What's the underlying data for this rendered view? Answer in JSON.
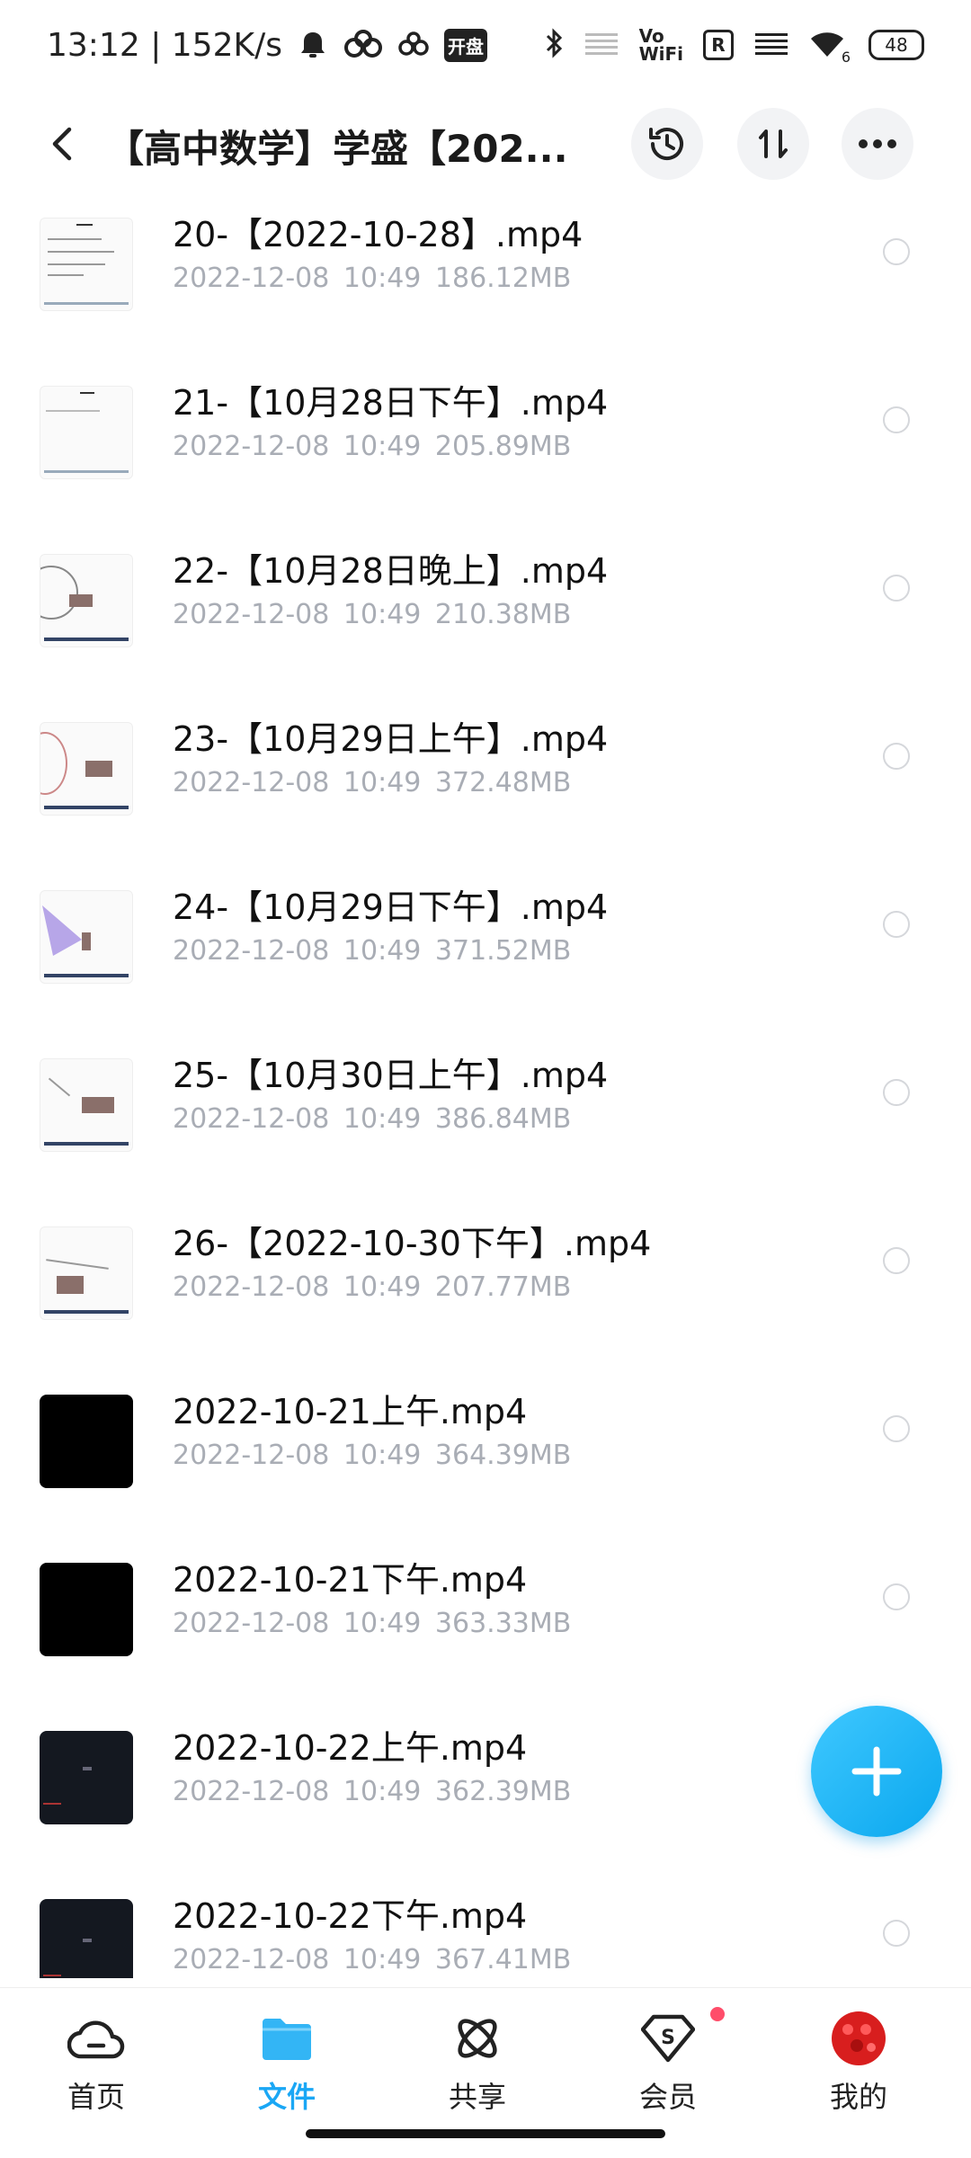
{
  "status_bar": {
    "time_speed": "13:12 | 152K/s",
    "kai_badge": "开盘",
    "vo": "Vo",
    "wifi": "WiFi",
    "r_badge": "R",
    "wifi_sub": "6",
    "battery": "48"
  },
  "header": {
    "title": "【高中数学】学盛【202..."
  },
  "files": [
    {
      "name": "20-【2022-10-28】.mp4",
      "date": "2022-12-08",
      "time": "10:49",
      "size": "186.12MB"
    },
    {
      "name": "21-【10月28日下午】.mp4",
      "date": "2022-12-08",
      "time": "10:49",
      "size": "205.89MB"
    },
    {
      "name": "22-【10月28日晚上】.mp4",
      "date": "2022-12-08",
      "time": "10:49",
      "size": "210.38MB"
    },
    {
      "name": "23-【10月29日上午】.mp4",
      "date": "2022-12-08",
      "time": "10:49",
      "size": "372.48MB"
    },
    {
      "name": "24-【10月29日下午】.mp4",
      "date": "2022-12-08",
      "time": "10:49",
      "size": "371.52MB"
    },
    {
      "name": "25-【10月30日上午】.mp4",
      "date": "2022-12-08",
      "time": "10:49",
      "size": "386.84MB"
    },
    {
      "name": "26-【2022-10-30下午】.mp4",
      "date": "2022-12-08",
      "time": "10:49",
      "size": "207.77MB"
    },
    {
      "name": "2022-10-21上午.mp4",
      "date": "2022-12-08",
      "time": "10:49",
      "size": "364.39MB"
    },
    {
      "name": "2022-10-21下午.mp4",
      "date": "2022-12-08",
      "time": "10:49",
      "size": "363.33MB"
    },
    {
      "name": "2022-10-22上午.mp4",
      "date": "2022-12-08",
      "time": "10:49",
      "size": "362.39MB"
    },
    {
      "name": "2022-10-22下午.mp4",
      "date": "2022-12-08",
      "time": "10:49",
      "size": "367.41MB"
    }
  ],
  "nav": {
    "home": "首页",
    "files": "文件",
    "share": "共享",
    "member": "会员",
    "mine": "我的"
  },
  "colors": {
    "accent": "#1aa7f5",
    "meta_text": "#a9adb5",
    "badge_dot": "#ff4d6a"
  }
}
